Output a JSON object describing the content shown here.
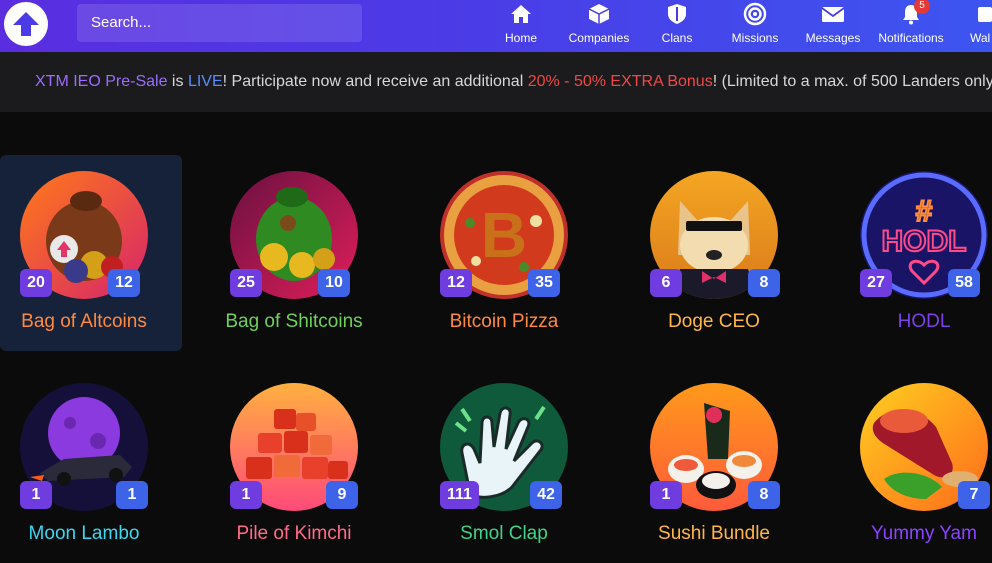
{
  "header": {
    "search_placeholder": "Search...",
    "nav": [
      {
        "label": "Home",
        "icon": "home-icon"
      },
      {
        "label": "Companies",
        "icon": "box-icon"
      },
      {
        "label": "Clans",
        "icon": "shield-icon"
      },
      {
        "label": "Missions",
        "icon": "target-icon"
      },
      {
        "label": "Messages",
        "icon": "envelope-icon"
      },
      {
        "label": "Notifications",
        "icon": "bell-icon",
        "badge": "5"
      },
      {
        "label": "Wal",
        "icon": "wallet-icon"
      }
    ]
  },
  "announcement": {
    "part1": "XTM IEO Pre-Sale",
    "part2": " is ",
    "part3": "LIVE",
    "part4": "! Participate now and receive an additional ",
    "part5": "20% - 50% EXTRA Bonus",
    "part6": "! (Limited to a max. of 500 Landers only)"
  },
  "items": [
    {
      "name": "Bag of Altcoins",
      "left": "20",
      "right": "12",
      "name_color": "#ff8a3d",
      "selected": true,
      "icon": "coin-bag-icon"
    },
    {
      "name": "Bag of Shitcoins",
      "left": "25",
      "right": "10",
      "name_color": "#6fd05a",
      "selected": false,
      "icon": "coin-bag-icon"
    },
    {
      "name": "Bitcoin Pizza",
      "left": "12",
      "right": "35",
      "name_color": "#ff8a3d",
      "selected": false,
      "icon": "pizza-icon"
    },
    {
      "name": "Doge CEO",
      "left": "6",
      "right": "8",
      "name_color": "#ffb648",
      "selected": false,
      "icon": "doge-icon"
    },
    {
      "name": "HODL",
      "left": "27",
      "right": "58",
      "name_color": "#7c3fe8",
      "selected": false,
      "icon": "neon-sign-icon"
    },
    {
      "name": "Moon Lambo",
      "left": "1",
      "right": "1",
      "name_color": "#3bd6f0",
      "selected": false,
      "icon": "car-icon"
    },
    {
      "name": "Pile of Kimchi",
      "left": "1",
      "right": "9",
      "name_color": "#ff6b8a",
      "selected": false,
      "icon": "kimchi-icon"
    },
    {
      "name": "Smol Clap",
      "left": "111",
      "right": "42",
      "name_color": "#3ed28a",
      "selected": false,
      "icon": "clap-icon"
    },
    {
      "name": "Sushi Bundle",
      "left": "1",
      "right": "8",
      "name_color": "#ffb648",
      "selected": false,
      "icon": "sushi-icon"
    },
    {
      "name": "Yummy Yam",
      "left": "",
      "right": "7",
      "name_color": "#8a44ff",
      "selected": false,
      "icon": "yam-icon"
    }
  ]
}
